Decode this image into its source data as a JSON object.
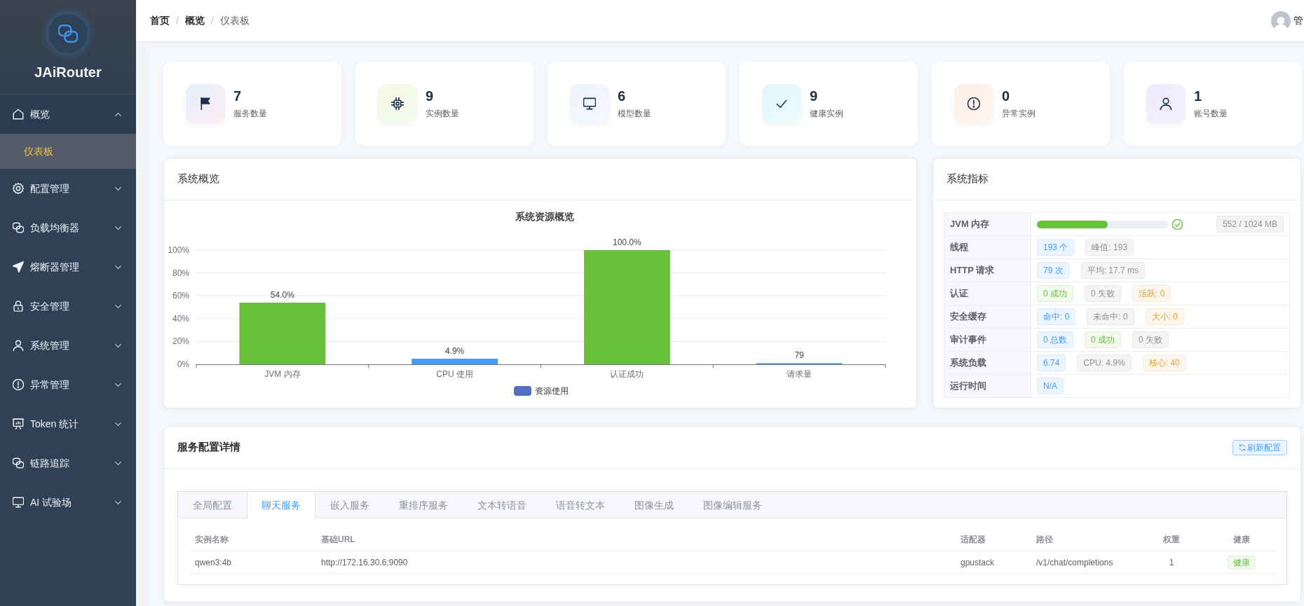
{
  "sidebar": {
    "app_name": "JAiRouter",
    "items": [
      {
        "label": "概览",
        "expanded": true,
        "children": [
          {
            "label": "仪表板",
            "selected": true
          }
        ]
      },
      {
        "label": "配置管理",
        "expanded": false
      },
      {
        "label": "负载均衡器",
        "expanded": false
      },
      {
        "label": "熔断器管理",
        "expanded": false
      },
      {
        "label": "安全管理",
        "expanded": false
      },
      {
        "label": "系统管理",
        "expanded": false
      },
      {
        "label": "异常管理",
        "expanded": false
      },
      {
        "label": "Token 统计",
        "expanded": false
      },
      {
        "label": "链路追踪",
        "expanded": false
      },
      {
        "label": "AI 试验场",
        "expanded": false
      }
    ]
  },
  "header": {
    "breadcrumb": [
      {
        "label": "首页",
        "current": false,
        "separator": "/"
      },
      {
        "label": "概览",
        "current": false,
        "separator": "/"
      },
      {
        "label": "仪表板",
        "current": true
      }
    ],
    "user": {
      "name": "管"
    }
  },
  "stats": [
    {
      "value": "7",
      "label": "服务数量"
    },
    {
      "value": "9",
      "label": "实例数量"
    },
    {
      "value": "6",
      "label": "模型数量"
    },
    {
      "value": "9",
      "label": "健康实例"
    },
    {
      "value": "0",
      "label": "异常实例"
    },
    {
      "value": "1",
      "label": "账号数量"
    }
  ],
  "overview": {
    "title": "系统概览",
    "chart_data": {
      "type": "bar",
      "title": "系统资源概览",
      "categories": [
        "JVM 内存",
        "CPU 使用",
        "认证成功",
        "请求量"
      ],
      "series": [
        {
          "color": "#67c23a",
          "values": [
            54.0,
            null,
            100.0,
            null
          ]
        },
        {
          "color": "#409eff",
          "values": [
            null,
            4.9,
            null,
            1
          ]
        }
      ],
      "ylim": [
        0,
        100
      ],
      "yticks": [
        {
          "value": 0,
          "label": "0%"
        },
        {
          "value": 20,
          "label": "20%"
        },
        {
          "value": 40,
          "label": "40%"
        },
        {
          "value": 60,
          "label": "60%"
        },
        {
          "value": 80,
          "label": "80%"
        },
        {
          "value": 100,
          "label": "100%"
        }
      ],
      "grid": true,
      "value_labels": [
        "54.0%",
        "4.9%",
        "100.0%",
        "79"
      ]
    },
    "legend": {
      "label": "资源使用",
      "color": "#5470c6"
    }
  },
  "metrics": {
    "title": "系统指标",
    "rows": [
      {
        "label": "JVM 内存",
        "kind": "progress",
        "level": 0.54,
        "healthy": true,
        "reading": "552 / 1024 MB"
      },
      {
        "label": "线程",
        "kind": "tags",
        "tags": [
          {
            "text": "193 个",
            "kind": "primary"
          },
          {
            "text": "峰值: 193",
            "kind": "info"
          }
        ]
      },
      {
        "label": "HTTP 请求",
        "kind": "tags",
        "tags": [
          {
            "text": "79 次",
            "kind": "primary"
          },
          {
            "text": "平均: 17.7 ms",
            "kind": "info"
          }
        ]
      },
      {
        "label": "认证",
        "kind": "tags",
        "tags": [
          {
            "text": "0 成功",
            "kind": "success"
          },
          {
            "text": "0 失败",
            "kind": "info"
          },
          {
            "text": "活跃: 0",
            "kind": "warning"
          }
        ]
      },
      {
        "label": "安全缓存",
        "kind": "tags",
        "tags": [
          {
            "text": "命中: 0",
            "kind": "primary"
          },
          {
            "text": "未命中: 0",
            "kind": "info"
          },
          {
            "text": "大小: 0",
            "kind": "warning"
          }
        ]
      },
      {
        "label": "审计事件",
        "kind": "tags",
        "tags": [
          {
            "text": "0 总数",
            "kind": "primary"
          },
          {
            "text": "0 成功",
            "kind": "success"
          },
          {
            "text": "0 失败",
            "kind": "info"
          }
        ]
      },
      {
        "label": "系统负载",
        "kind": "tags",
        "tags": [
          {
            "text": "6.74",
            "kind": "primary"
          },
          {
            "text": "CPU: 4.9%",
            "kind": "info"
          },
          {
            "text": "核心: 40",
            "kind": "warning"
          }
        ]
      },
      {
        "label": "运行时间",
        "kind": "tags",
        "tags": [
          {
            "text": "N/A",
            "kind": "primary"
          }
        ]
      }
    ]
  },
  "services": {
    "title": "服务配置详情",
    "refresh_button": "刷新配置",
    "tabs": [
      {
        "label": "全局配置",
        "selected": false
      },
      {
        "label": "聊天服务",
        "selected": true
      },
      {
        "label": "嵌入服务",
        "selected": false
      },
      {
        "label": "重排序服务",
        "selected": false
      },
      {
        "label": "文本转语音",
        "selected": false
      },
      {
        "label": "语音转文本",
        "selected": false
      },
      {
        "label": "图像生成",
        "selected": false
      },
      {
        "label": "图像编辑服务",
        "selected": false
      }
    ],
    "table": {
      "columns": [
        "实例名称",
        "基础URL",
        "适配器",
        "路径",
        "权重",
        "健康"
      ],
      "rows": [
        {
          "cells": [
            "qwen3:4b",
            "http://172.16.30.6:9090",
            "gpustack",
            "/v1/chat/completions",
            "1"
          ],
          "health": {
            "text": "健康",
            "kind": "success"
          }
        }
      ]
    }
  }
}
